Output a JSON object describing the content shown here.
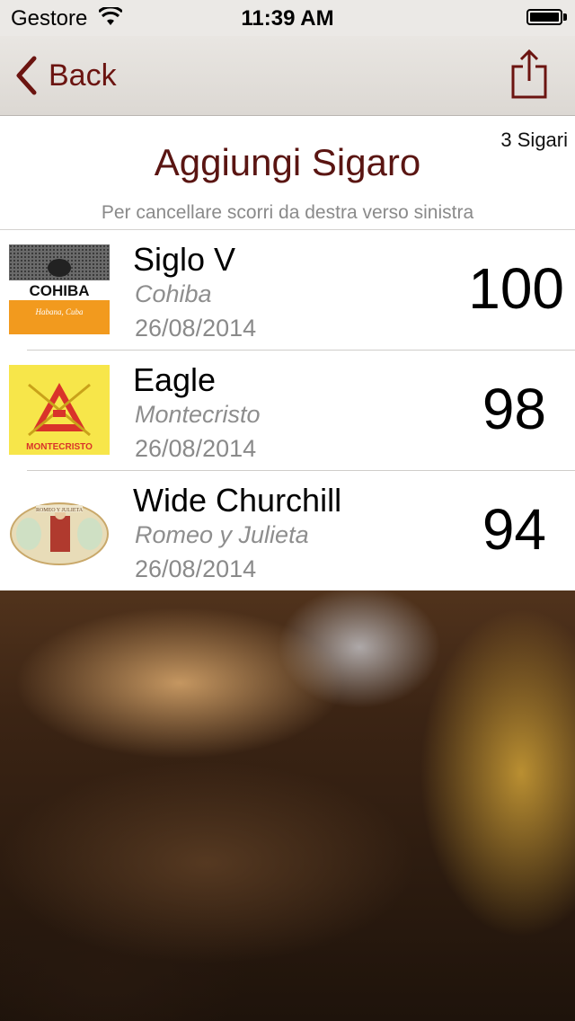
{
  "status_bar": {
    "carrier": "Gestore",
    "time": "11:39 AM"
  },
  "nav": {
    "back_label": "Back",
    "share_icon": "share-icon"
  },
  "header": {
    "count": "3 Sigari",
    "add_label": "Aggiungi Sigaro",
    "hint": "Per cancellare scorri da destra verso sinistra"
  },
  "cigars": [
    {
      "name": "Siglo V",
      "brand": "Cohiba",
      "date": "26/08/2014",
      "score": "100",
      "logo_text": "COHIBA",
      "logo_sub": "Habana, Cuba"
    },
    {
      "name": "Eagle",
      "brand": "Montecristo",
      "date": "26/08/2014",
      "score": "98",
      "logo_text": "MONTECRISTO"
    },
    {
      "name": "Wide Churchill",
      "brand": "Romeo y Julieta",
      "date": "26/08/2014",
      "score": "94",
      "logo_text": "ROMEO Y JULIETA"
    }
  ],
  "colors": {
    "accent": "#6b1410",
    "title": "#5a1512"
  }
}
